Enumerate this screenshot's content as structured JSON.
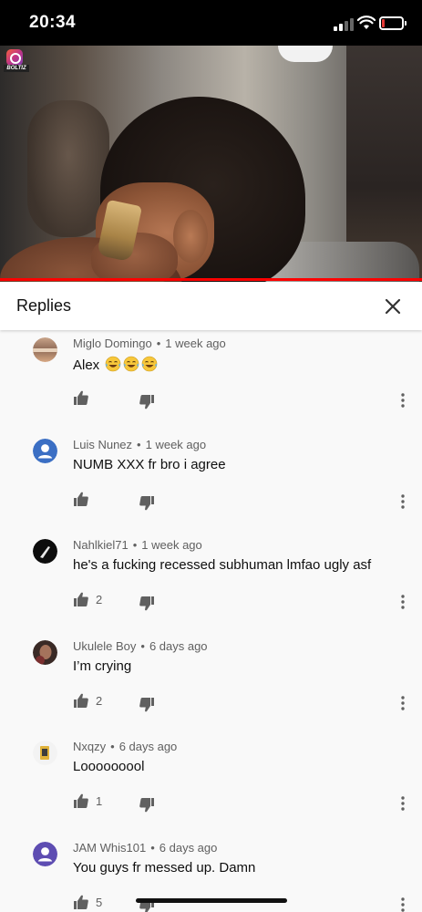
{
  "status_bar": {
    "time": "20:34",
    "battery_level": 0.15,
    "battery_color": "#e53935"
  },
  "video": {
    "channel_logo_text": "BOLTIZ",
    "progress": 1.0,
    "progress_color": "#ff0000"
  },
  "replies_panel": {
    "title": "Replies",
    "close_icon": "close-icon"
  },
  "replies": [
    {
      "author": "Miglo Domingo",
      "separator": "•",
      "time": "1 week ago",
      "text": "Alex",
      "emoji": [
        "face-with-tears-of-joy",
        "face-with-tears-of-joy",
        "face-with-tears-of-joy"
      ],
      "likes": "",
      "avatar": "photo-avatar-brown"
    },
    {
      "author": "Luis Nunez",
      "separator": "•",
      "time": "1 week ago",
      "text": "NUMB XXX fr bro i agree",
      "likes": "",
      "avatar": "default-blue-avatar"
    },
    {
      "author": "Nahlkiel71",
      "separator": "•",
      "time": "1 week ago",
      "text": "he's a fucking recessed subhuman lmfao ugly asf",
      "likes": "2",
      "avatar": "photo-avatar-dark"
    },
    {
      "author": "Ukulele Boy",
      "separator": "•",
      "time": "6 days ago",
      "text": "I’m crying",
      "likes": "2",
      "avatar": "photo-avatar-skin"
    },
    {
      "author": "Nxqzy",
      "separator": "•",
      "time": "6 days ago",
      "text": "Looooooool",
      "likes": "1",
      "avatar": "photo-avatar-yellow"
    },
    {
      "author": "JAM Whis101",
      "separator": "•",
      "time": "6 days ago",
      "text": "You guys fr messed up. Damn",
      "likes": "5",
      "avatar": "default-purple-avatar"
    }
  ],
  "icons": {
    "like": "thumbs-up-icon",
    "dislike": "thumbs-down-icon",
    "more": "more-vert-icon"
  }
}
